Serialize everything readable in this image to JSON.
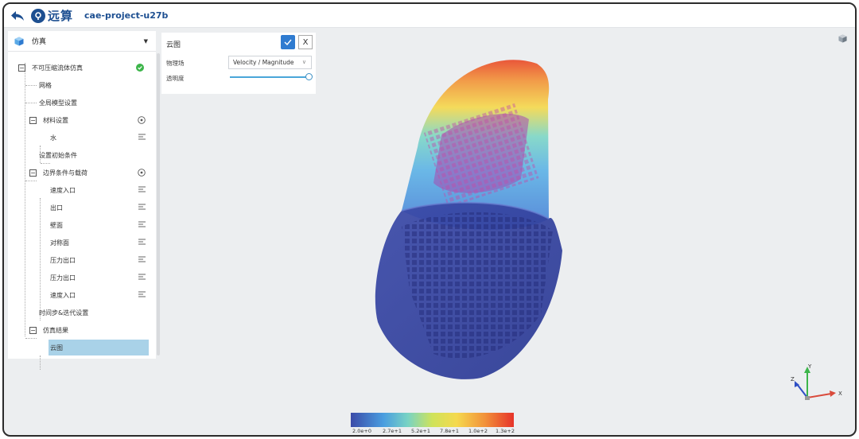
{
  "header": {
    "logo_text": "远算",
    "project_name": "cae-project-u27b"
  },
  "sidebar": {
    "selector_label": "仿真",
    "tree": {
      "root": "不可压缩流体仿真",
      "mesh": "网格",
      "global_model": "全局模型设置",
      "materials": "材料设置",
      "water": "水",
      "initial_conditions": "设置初始条件",
      "boundary": "边界条件与载荷",
      "bc_items": [
        "速度入口",
        "出口",
        "壁面",
        "对称面",
        "压力出口",
        "压力出口",
        "速度入口"
      ],
      "time_step": "时间步&迭代设置",
      "results": "仿真结果",
      "contour": "云图"
    }
  },
  "panel": {
    "title": "云图",
    "field_label": "物理场",
    "field_value": "Velocity / Magnitude",
    "opacity_label": "透明度",
    "opacity_value": 1.0,
    "close_glyph": "X"
  },
  "legend": {
    "ticks": [
      "2.0e+0",
      "2.7e+1",
      "5.2e+1",
      "7.8e+1",
      "1.0e+2",
      "1.3e+2"
    ]
  },
  "axes": {
    "x": "X",
    "y": "Y",
    "z": "Z"
  },
  "colors": {
    "brand": "#1d4f91",
    "accent": "#2f7bd0",
    "selected": "#a9d2e8",
    "status_ok": "#3cb54a"
  }
}
